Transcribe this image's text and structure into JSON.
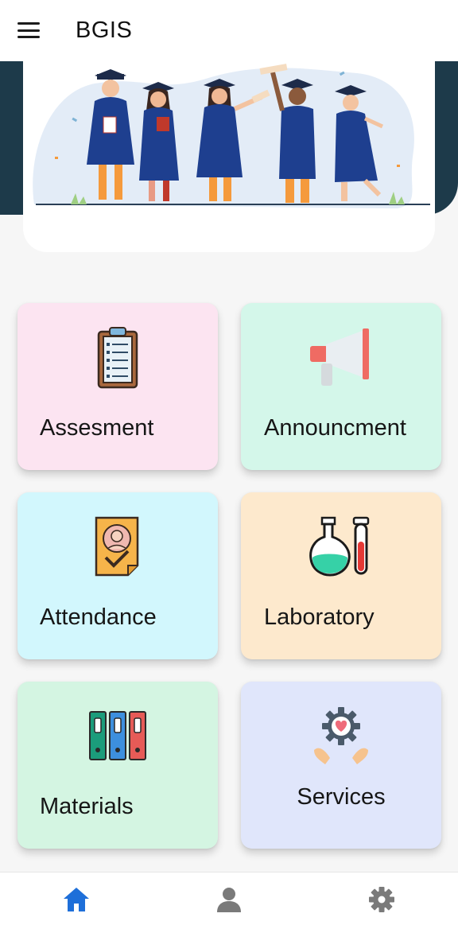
{
  "appbar": {
    "title": "BGIS",
    "menu_icon": "hamburger-menu-icon"
  },
  "banner": {
    "image": "graduates-illustration",
    "colors": {
      "dark_band": "#1d3a4a",
      "gown": "#1e3f8f"
    }
  },
  "tiles": [
    {
      "label": "Assesment",
      "icon": "clipboard-icon",
      "color": "#fce4f1"
    },
    {
      "label": "Announcment",
      "icon": "megaphone-icon",
      "color": "#d4f7ea"
    },
    {
      "label": "Attendance",
      "icon": "person-check-icon",
      "color": "#d2f7fd"
    },
    {
      "label": "Laboratory",
      "icon": "flask-test-tube-icon",
      "color": "#fde9cd"
    },
    {
      "label": "Materials",
      "icon": "binders-icon",
      "color": "#d4f5e2"
    },
    {
      "label": "Services",
      "icon": "gear-heart-hands-icon",
      "color": "#e0e6fb"
    }
  ],
  "bottom_nav": {
    "items": [
      {
        "icon": "home-icon",
        "active": true
      },
      {
        "icon": "profile-icon",
        "active": false
      },
      {
        "icon": "settings-gear-icon",
        "active": false
      }
    ],
    "active_color": "#1e6fd9",
    "inactive_color": "#7a7a7a"
  }
}
